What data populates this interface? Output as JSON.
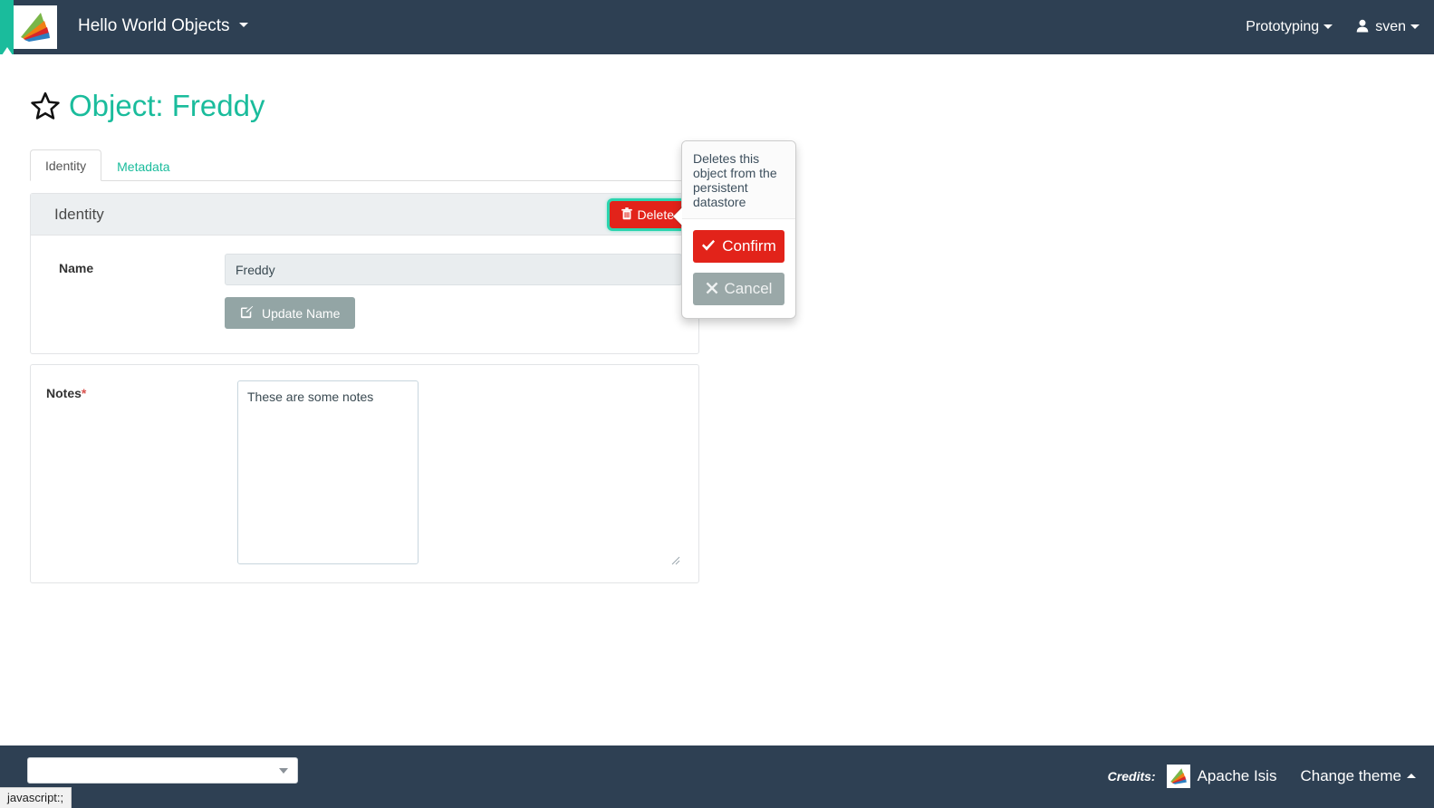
{
  "navbar": {
    "brand_title": "Hello World Objects",
    "brand_logo_icon": "apache-isis-logo-icon",
    "brand_caret_icon": "caret-down-icon",
    "menu_prototyping": "Prototyping",
    "prototyping_caret_icon": "caret-down-icon",
    "user_name": "sven",
    "user_icon": "user-icon",
    "user_caret_icon": "caret-down-icon"
  },
  "page": {
    "title": "Object: Freddy",
    "bookmark_icon": "star-outline-icon"
  },
  "tabs": [
    {
      "label": "Identity",
      "active": true
    },
    {
      "label": "Metadata",
      "active": false
    }
  ],
  "identity_panel": {
    "heading": "Identity",
    "delete_button": {
      "label": "Delete",
      "icon": "trash-icon",
      "bg_color": "#e2231a",
      "focus_ring_color": "#2ad4ae"
    },
    "name_field": {
      "label": "Name",
      "value": "Freddy"
    },
    "update_button": {
      "label": "Update Name",
      "icon": "edit-pencil-square-icon"
    }
  },
  "notes_panel": {
    "label": "Notes",
    "required_marker": "*",
    "value": "These are some notes",
    "placeholder": ""
  },
  "popover": {
    "title": "Deletes this object from the persistent datastore",
    "confirm": {
      "label": "Confirm",
      "icon": "check-icon",
      "bg_color": "#e2231a"
    },
    "cancel": {
      "label": "Cancel",
      "icon": "times-icon",
      "bg_color": "#9aa8a8"
    }
  },
  "footer": {
    "select_value": "",
    "select_icon": "caret-down-icon",
    "credits_label": "Credits:",
    "credits_link": "Apache Isis",
    "credits_logo_icon": "apache-isis-logo-icon",
    "change_theme": "Change theme",
    "change_theme_caret_icon": "caret-up-icon"
  },
  "browser": {
    "status_text": "javascript:;"
  },
  "colors": {
    "navbar_bg": "#2e4053",
    "accent_teal": "#1abc9c",
    "danger_red": "#e2231a",
    "muted_grey": "#93a5a5",
    "panel_heading_bg": "#eceff1"
  }
}
